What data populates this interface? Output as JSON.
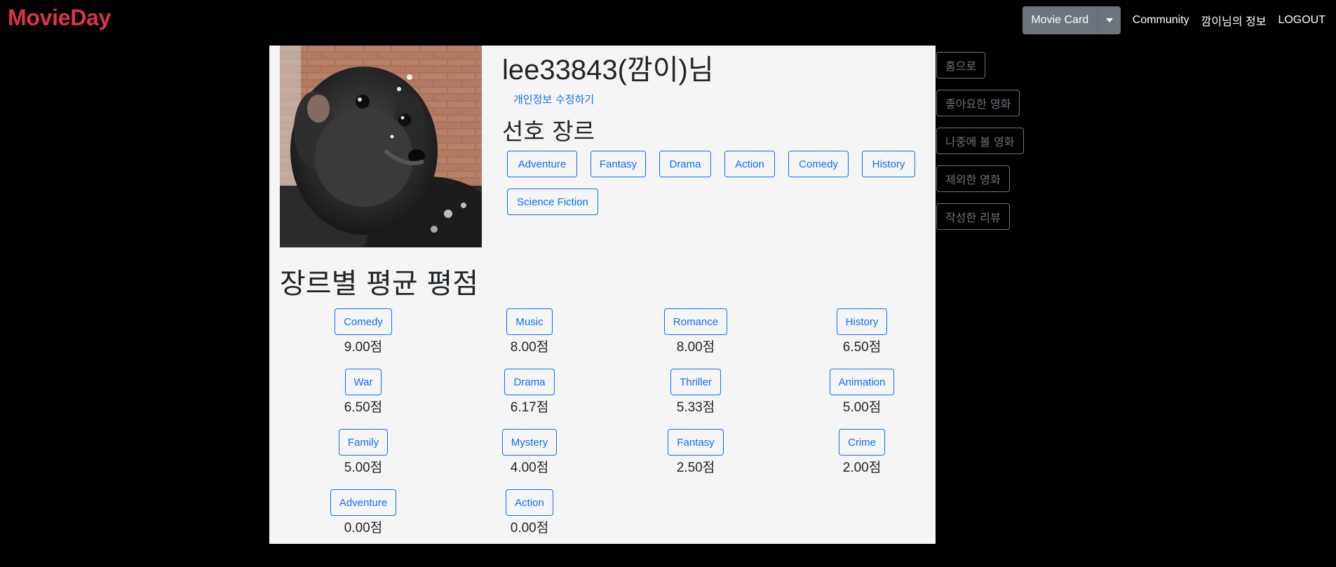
{
  "navbar": {
    "brand": "MovieDay",
    "movie_card_label": "Movie Card",
    "community_label": "Community",
    "my_info_label": "깜이님의 정보",
    "logout_label": "LOGOUT"
  },
  "profile": {
    "title": "lee33843(깜이)님",
    "edit_link": "개인정보 수정하기",
    "preferred_title": "선호 장르",
    "preferred_genres": [
      "Adventure",
      "Fantasy",
      "Drama",
      "Action",
      "Comedy",
      "History",
      "Science Fiction"
    ]
  },
  "averages": {
    "title": "장르별 평균 평점",
    "items": [
      {
        "genre": "Comedy",
        "score": "9.00점"
      },
      {
        "genre": "Music",
        "score": "8.00점"
      },
      {
        "genre": "Romance",
        "score": "8.00점"
      },
      {
        "genre": "History",
        "score": "6.50점"
      },
      {
        "genre": "War",
        "score": "6.50점"
      },
      {
        "genre": "Drama",
        "score": "6.17점"
      },
      {
        "genre": "Thriller",
        "score": "5.33점"
      },
      {
        "genre": "Animation",
        "score": "5.00점"
      },
      {
        "genre": "Family",
        "score": "5.00점"
      },
      {
        "genre": "Mystery",
        "score": "4.00점"
      },
      {
        "genre": "Fantasy",
        "score": "2.50점"
      },
      {
        "genre": "Crime",
        "score": "2.00점"
      },
      {
        "genre": "Adventure",
        "score": "0.00점"
      },
      {
        "genre": "Action",
        "score": "0.00점"
      }
    ]
  },
  "side_menu": {
    "items": [
      "홈으로",
      "좋아요한 영화",
      "나중에 볼 영화",
      "제외한 영화",
      "작성한 리뷰"
    ]
  },
  "colors": {
    "brand": "#dc3545",
    "primary": "#0d6efd",
    "secondary": "#6c757d",
    "panel_bg": "#f5f5f5",
    "page_bg": "#000000"
  }
}
